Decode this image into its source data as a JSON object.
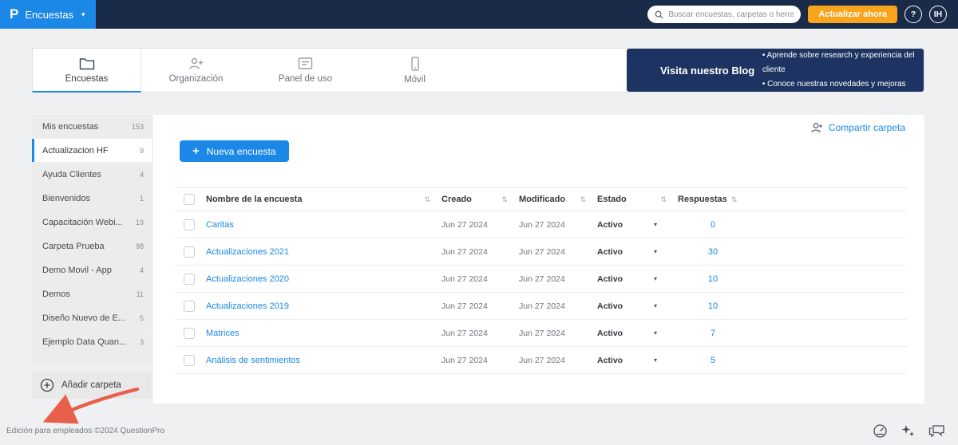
{
  "header": {
    "logo_letter": "P",
    "app_menu_label": "Encuestas",
    "search_placeholder": "Buscar encuestas, carpetas o herrami",
    "update_button_label": "Actualizar ahora",
    "help_label": "?",
    "avatar_initials": "IH"
  },
  "tabs": [
    {
      "label": "Encuestas",
      "active": true
    },
    {
      "label": "Organización",
      "active": false
    },
    {
      "label": "Panel de uso",
      "active": false
    },
    {
      "label": "Móvil",
      "active": false
    }
  ],
  "blog_banner": {
    "title": "Visita nuestro Blog",
    "bullets": [
      {
        "text": "Aprende sobre research y experiencia del cliente"
      },
      {
        "text": "Conoce nuestras novedades y mejoras"
      }
    ]
  },
  "sidebar": {
    "folders": [
      {
        "label": "Mis encuestas",
        "count": "153",
        "selected": false
      },
      {
        "label": "Actualizacion HF",
        "count": "9",
        "selected": true
      },
      {
        "label": "Ayuda Clientes",
        "count": "4",
        "selected": false
      },
      {
        "label": "Bienvenidos",
        "count": "1",
        "selected": false
      },
      {
        "label": "Capacitación Webi...",
        "count": "19",
        "selected": false
      },
      {
        "label": "Carpeta Prueba",
        "count": "98",
        "selected": false
      },
      {
        "label": "Demo Movil - App",
        "count": "4",
        "selected": false
      },
      {
        "label": "Demos",
        "count": "11",
        "selected": false
      },
      {
        "label": "Diseño Nuevo de E...",
        "count": "5",
        "selected": false
      },
      {
        "label": "Ejemplo Data Quan...",
        "count": "3",
        "selected": false
      }
    ],
    "add_folder_label": "Añadir carpeta"
  },
  "content": {
    "share_folder_label": "Compartir carpeta",
    "new_survey_label": "Nueva encuesta",
    "table": {
      "columns": [
        "Nombre de la encuesta",
        "Creado",
        "Modificado",
        "Estado",
        "Respuestas"
      ],
      "rows": [
        {
          "name": "Caritas",
          "created": "Jun 27 2024",
          "modified": "Jun 27 2024",
          "status": "Activo",
          "responses": "0"
        },
        {
          "name": "Actualizaciones 2021",
          "created": "Jun 27 2024",
          "modified": "Jun 27 2024",
          "status": "Activo",
          "responses": "30"
        },
        {
          "name": "Actualizaciones 2020",
          "created": "Jun 27 2024",
          "modified": "Jun 27 2024",
          "status": "Activo",
          "responses": "10"
        },
        {
          "name": "Actualizaciones 2019",
          "created": "Jun 27 2024",
          "modified": "Jun 27 2024",
          "status": "Activo",
          "responses": "10"
        },
        {
          "name": "Matrices",
          "created": "Jun 27 2024",
          "modified": "Jun 27 2024",
          "status": "Activo",
          "responses": "7"
        },
        {
          "name": "Análisis de sentimientos",
          "created": "Jun 27 2024",
          "modified": "Jun 27 2024",
          "status": "Activo",
          "responses": "5"
        }
      ]
    }
  },
  "footer": {
    "text": "Edición para empleados ©2024 QuestionPro"
  },
  "colors": {
    "accent_blue": "#1b87e6",
    "topbar_navy": "#1a2b49",
    "banner_navy": "#1d3462",
    "action_orange": "#f8a41d"
  },
  "icons": [
    "search-icon",
    "caret-down-icon",
    "folder-tab-icon",
    "organization-icon",
    "usage-panel-icon",
    "mobile-icon",
    "share-person-icon",
    "plus-icon",
    "add-folder-circle-plus-icon",
    "sort-icon",
    "status-caret-icon",
    "gauge-icon",
    "sparkles-icon",
    "chat-icon",
    "annotation-arrow"
  ]
}
